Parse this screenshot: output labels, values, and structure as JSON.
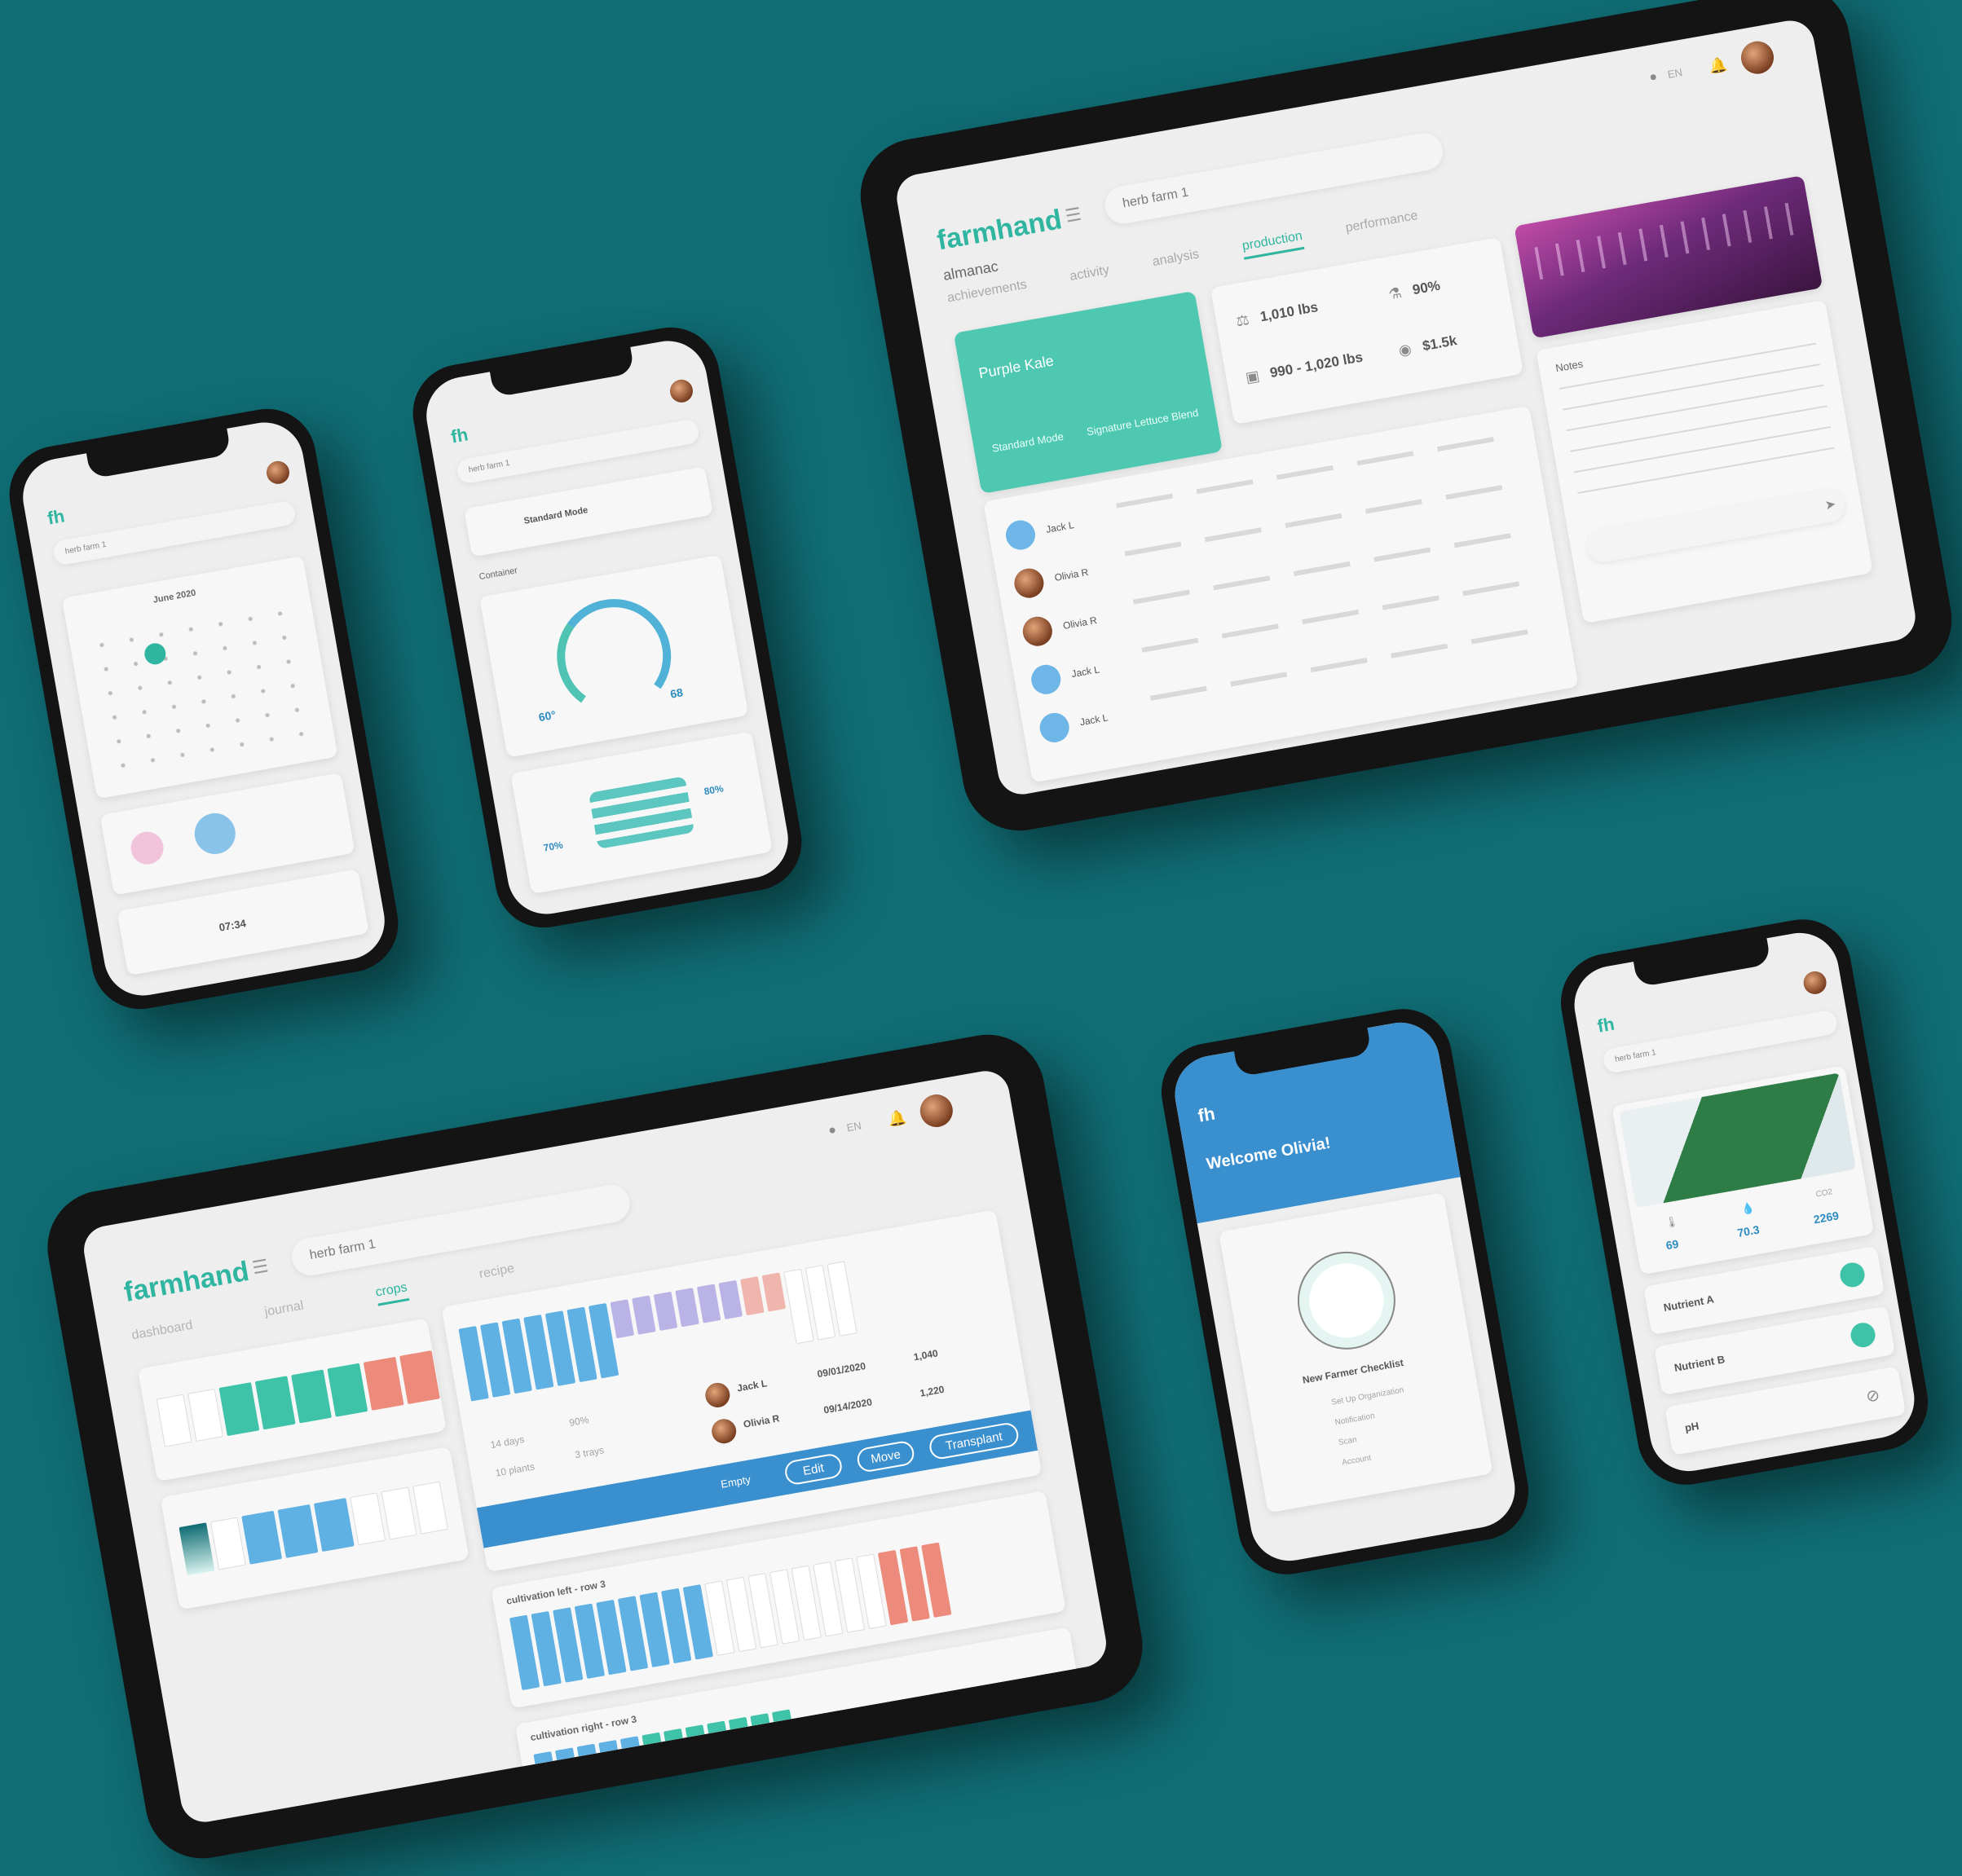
{
  "theme": {
    "background": "#106d74",
    "accent": "#2fb5a0",
    "blue": "#3a8fce"
  },
  "app": {
    "logo_full": "farmhand",
    "logo_short": "fh"
  },
  "tablet_production": {
    "farm_selector": "herb farm 1",
    "lang": "EN",
    "almanac": "almanac",
    "tabs": [
      "achievements",
      "activity",
      "analysis",
      "production",
      "performance"
    ],
    "active_tab": "production",
    "crop_card": {
      "name": "Purple Kale",
      "left_label": "Standard Mode",
      "right_label": "Signature Lettuce Blend"
    },
    "stats": [
      {
        "icon": "scale-icon",
        "value": "1,010 lbs"
      },
      {
        "icon": "flask-icon",
        "value": "90%"
      },
      {
        "icon": "box-icon",
        "value": "990 - 1,020 lbs"
      },
      {
        "icon": "coin-icon",
        "value": "$1.5k"
      }
    ],
    "activity_title": "Notes",
    "people": [
      {
        "name": "Jack L"
      },
      {
        "name": "Olivia R"
      },
      {
        "name": "Olivia R"
      },
      {
        "name": "Jack L"
      },
      {
        "name": "Jack L"
      }
    ]
  },
  "phone_calendar": {
    "farm_selector": "herb farm 1",
    "month": "June 2020",
    "time": "07:34"
  },
  "phone_climate": {
    "farm_selector": "herb farm 1",
    "mode": "Standard Mode",
    "section": "Container",
    "temp_left": "60°",
    "temp_right": "68",
    "humidity": "80%",
    "humidity_left": "70%"
  },
  "tablet_crops": {
    "farm_selector": "herb farm 1",
    "lang": "EN",
    "tabs": [
      "dashboard",
      "journal",
      "crops",
      "recipe"
    ],
    "active_tab": "crops",
    "people": [
      {
        "name": "Jack L",
        "date": "09/01/2020",
        "value": "1,040"
      },
      {
        "name": "Olivia R",
        "date": "09/14/2020",
        "value": "1,220"
      }
    ],
    "stats": [
      "14 days",
      "90%",
      "10 plants",
      "3 trays"
    ],
    "actions": [
      "Empty",
      "Edit",
      "Move",
      "Transplant"
    ],
    "row_titles": [
      "cultivation left - row 3",
      "cultivation right - row 3"
    ]
  },
  "phone_welcome": {
    "greeting": "Welcome Olivia!",
    "checklist_title": "New Farmer Checklist",
    "checklist": [
      "Set Up Organization",
      "Notification",
      "Scan",
      "Account"
    ]
  },
  "phone_nutrients": {
    "farm_selector": "herb farm 1",
    "metrics": [
      {
        "icon": "thermometer-icon",
        "value": "69"
      },
      {
        "icon": "droplet-icon",
        "value": "70.3"
      },
      {
        "icon": "co2-icon",
        "label": "CO2",
        "value": "2269"
      }
    ],
    "controls": [
      "Nutrient A",
      "Nutrient B",
      "pH"
    ]
  }
}
